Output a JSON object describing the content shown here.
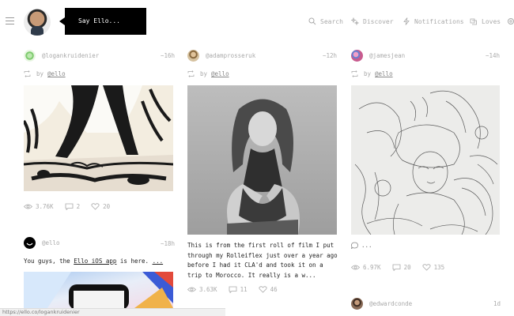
{
  "header": {
    "say_ello": "Say Ello...",
    "nav": {
      "search": "Search",
      "discover": "Discover",
      "notifications": "Notifications",
      "loves": "Loves"
    }
  },
  "posts": [
    {
      "username": "@logankruidenier",
      "time": "~16h",
      "repost_by": "by",
      "repost_user": "@ello",
      "views": "3.76K",
      "comments": "2",
      "loves": "20"
    },
    {
      "username": "@adamprosseruk",
      "time": "~12h",
      "repost_by": "by",
      "repost_user": "@ello",
      "body_lines": [
        "This is from the first roll of film I put",
        "through my Rolleiflex just over a year ago",
        "before I had it CLA'd and took it on a",
        "trip to Morocco. It really is a w..."
      ],
      "views": "3.63K",
      "comments": "11",
      "loves": "46"
    },
    {
      "username": "@jamesjean",
      "time": "~14h",
      "repost_by": "by",
      "repost_user": "@ello",
      "views": "6.97K",
      "comments": "20",
      "loves": "135"
    },
    {
      "username": "@ello",
      "time": "~18h",
      "body_prefix": "You guys, the",
      "body_link": "Ello iOS app",
      "body_suffix": "is here.",
      "body_more": "..."
    },
    {
      "username": "@edwardconde",
      "time": "1d"
    }
  ],
  "status_bar": "https://ello.co/logankruidenier",
  "colors": {
    "text_muted": "#aaaaaa",
    "text_dark": "#222222",
    "black": "#000000"
  }
}
